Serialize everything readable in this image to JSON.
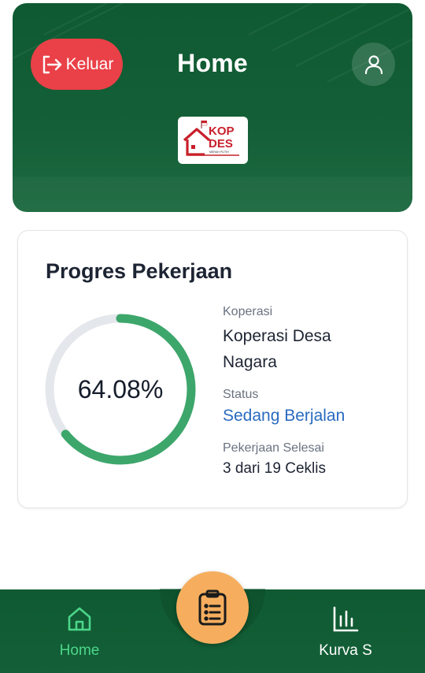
{
  "header": {
    "logout_label": "Keluar",
    "title": "Home",
    "logo": {
      "line1": "KOP",
      "line2": "DES",
      "tagline": "MERAH PUTIH"
    }
  },
  "progress_card": {
    "title": "Progres Pekerjaan",
    "percent": 64.08,
    "percent_label": "64.08%",
    "koperasi_label": "Koperasi",
    "koperasi_value_line1": "Koperasi Desa",
    "koperasi_value_line2": "Nagara",
    "status_label": "Status",
    "status_value": "Sedang Berjalan",
    "selesai_label": "Pekerjaan Selesai",
    "selesai_value": "3 dari 19 Ceklis"
  },
  "bottom_nav": {
    "items": [
      {
        "label": "Home",
        "icon": "home-icon",
        "active": true
      },
      {
        "label": "Kurva S",
        "icon": "bar-chart-icon",
        "active": false
      }
    ],
    "fab_icon": "clipboard-list-icon"
  },
  "colors": {
    "brand_green": "#145f37",
    "logout_red": "#ea4047",
    "progress_green": "#3da66b",
    "track_grey": "#e4e7eb",
    "status_blue": "#2a6bc0",
    "fab_orange": "#f6ae5e",
    "nav_active": "#4cd68a"
  }
}
